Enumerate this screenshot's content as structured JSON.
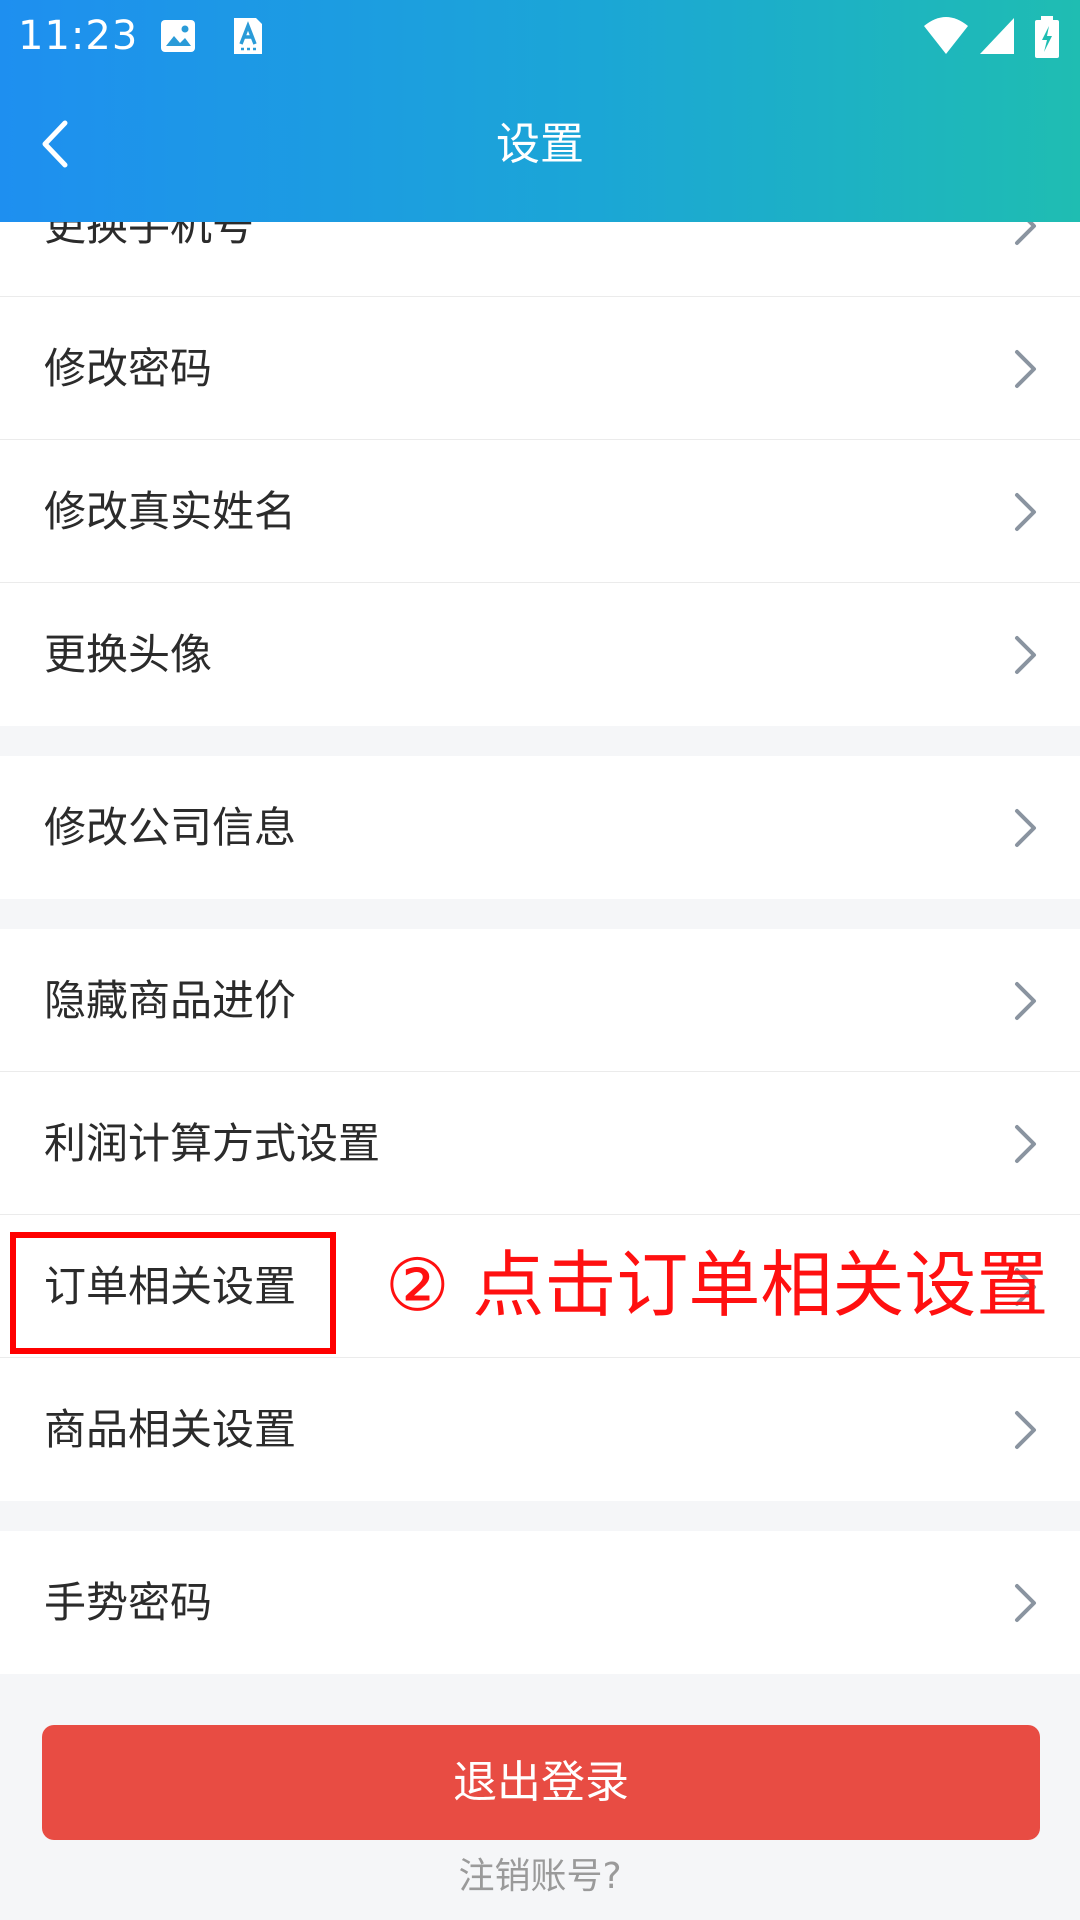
{
  "status_bar": {
    "time": "11:23",
    "icons": [
      "image-icon",
      "font-icon",
      "wifi-icon",
      "signal-icon",
      "battery-charging-icon"
    ]
  },
  "app_bar": {
    "title": "设置",
    "back_icon": "back-arrow-icon"
  },
  "list": {
    "partial_item": "更换手机号",
    "group1": [
      "修改密码",
      "修改真实姓名",
      "更换头像"
    ],
    "group2": [
      "修改公司信息"
    ],
    "group3": [
      "隐藏商品进价",
      "利润计算方式设置",
      "订单相关设置",
      "商品相关设置"
    ],
    "group4": [
      "手势密码"
    ],
    "chevron_icon": "chevron-right-icon"
  },
  "annotation": {
    "text": "② 点击订单相关设置",
    "color": "#ff1010"
  },
  "bottom": {
    "logout_label": "退出登录",
    "cancel_label": "注销账号?"
  },
  "colors": {
    "header_gradient_start": "#1e8ff0",
    "header_gradient_end": "#1fbdb2",
    "logout_button": "#e84c43",
    "annotation_red": "#ff0000"
  }
}
